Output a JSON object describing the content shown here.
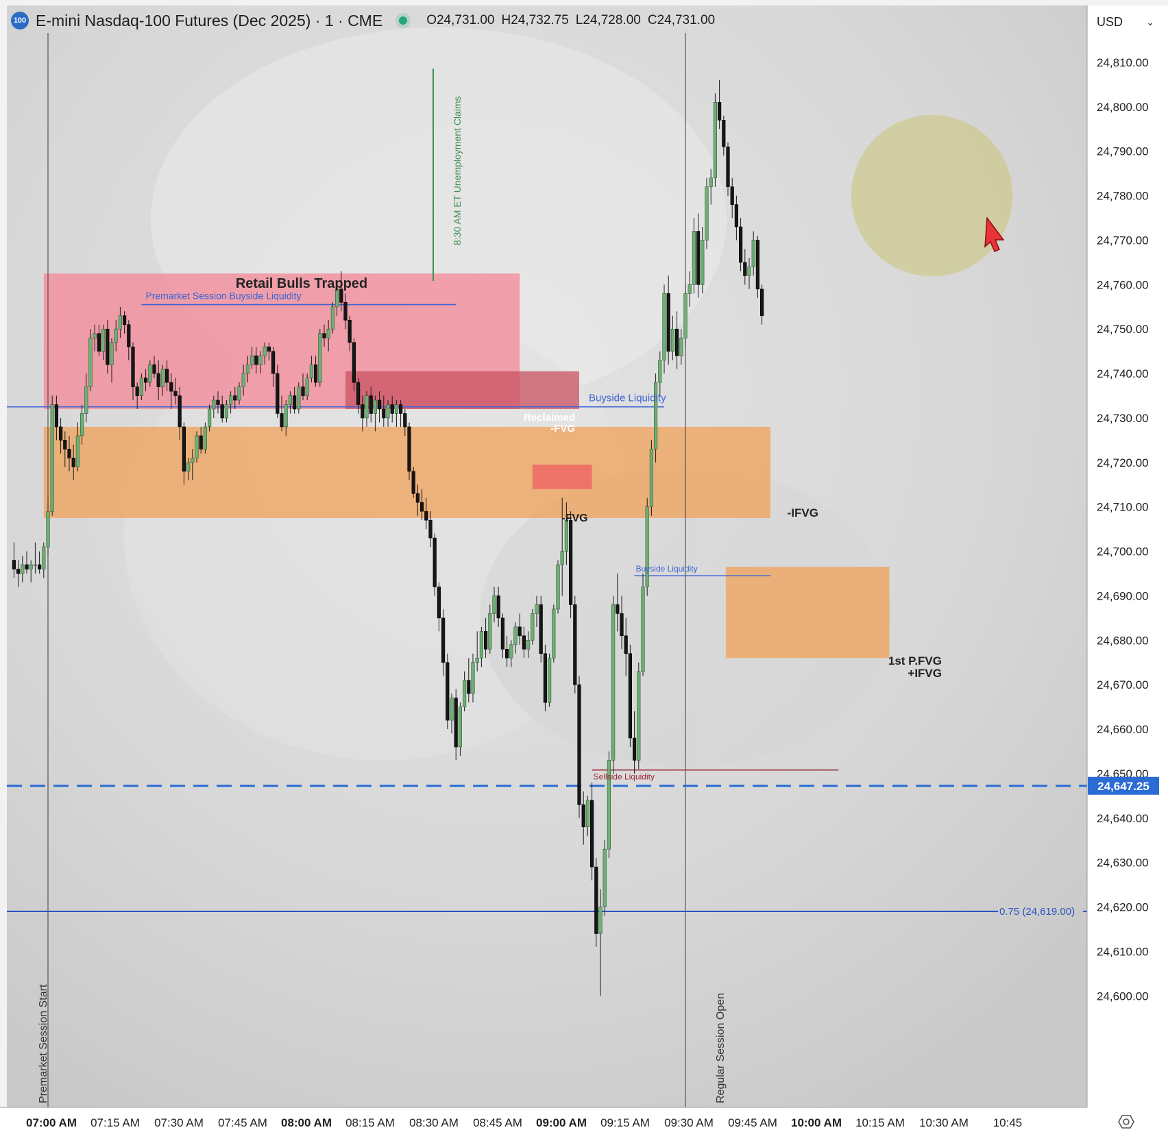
{
  "header": {
    "badge": "100",
    "title": "E-mini Nasdaq-100 Futures (Dec 2025) · 1 · CME",
    "open": "O24,731.00",
    "high": "H24,732.75",
    "low": "L24,728.00",
    "close": "C24,731.00"
  },
  "currency": "USD",
  "colors": {
    "up": "#6fae75",
    "down": "#161616",
    "blue_line": "#2a53c4",
    "red_zone": "#f28a9a",
    "orange_zone": "#f0a35e",
    "fvg_red": "#ee6264",
    "reclaimed_zone": "#c95363",
    "circle": "#cfc98f",
    "accent_label": "#2a6bd4"
  },
  "chart_data": {
    "type": "candlestick",
    "title": "E-mini Nasdaq-100 Futures (Dec 2025) · 1 · CME",
    "xlabel": "",
    "ylabel": "",
    "x_ticks": [
      {
        "t": "07:00 AM",
        "bold": true
      },
      {
        "t": "07:15 AM",
        "bold": false
      },
      {
        "t": "07:30 AM",
        "bold": false
      },
      {
        "t": "07:45 AM",
        "bold": false
      },
      {
        "t": "08:00 AM",
        "bold": true
      },
      {
        "t": "08:15 AM",
        "bold": false
      },
      {
        "t": "08:30 AM",
        "bold": false
      },
      {
        "t": "08:45 AM",
        "bold": false
      },
      {
        "t": "09:00 AM",
        "bold": true
      },
      {
        "t": "09:15 AM",
        "bold": false
      },
      {
        "t": "09:30 AM",
        "bold": false
      },
      {
        "t": "09:45 AM",
        "bold": false
      },
      {
        "t": "10:00 AM",
        "bold": true
      },
      {
        "t": "10:15 AM",
        "bold": false
      },
      {
        "t": "10:30 AM",
        "bold": false
      },
      {
        "t": "10:45",
        "bold": false
      }
    ],
    "y_ticks": [
      "24,600.00",
      "24,610.00",
      "24,620.00",
      "24,630.00",
      "24,640.00",
      "24,650.00",
      "24,660.00",
      "24,670.00",
      "24,680.00",
      "24,690.00",
      "24,700.00",
      "24,710.00",
      "24,720.00",
      "24,730.00",
      "24,740.00",
      "24,750.00",
      "24,760.00",
      "24,770.00",
      "24,780.00",
      "24,790.00",
      "24,800.00",
      "24,810.00"
    ],
    "ylim": [
      24596,
      24818
    ],
    "current_price": {
      "value": 24647.25,
      "label": "24,647.25"
    },
    "vertical_markers": [
      {
        "time_min": 0,
        "label": "Premarket Session Start"
      },
      {
        "time_min": 150,
        "label": "Regular Session Open"
      },
      {
        "time_min": 90,
        "label": "8:30 AM ET Unemployment Claims"
      }
    ],
    "zones": [
      {
        "name": "retail-bulls-trapped-zone",
        "t0": -1,
        "t1": 111,
        "p_low": 24732,
        "p_high": 24762.5,
        "color": "red_zone",
        "label": "Retail Bulls Trapped"
      },
      {
        "name": "reclaimed-fvg-zone",
        "t0": 70,
        "t1": 125,
        "p_low": 24732,
        "p_high": 24740.5,
        "color": "reclaimed_zone",
        "label": "Reclaimed -FVG"
      },
      {
        "name": "ifvg-zone",
        "t0": -1,
        "t1": 170,
        "p_low": 24707.5,
        "p_high": 24728,
        "color": "orange_zone",
        "label": "-IFVG"
      },
      {
        "name": "fvg-zone",
        "t0": 114,
        "t1": 128,
        "p_low": 24714,
        "p_high": 24719.5,
        "color": "fvg_red",
        "label": "-FVG"
      },
      {
        "name": "first-p-fvg-zone",
        "t0": 159.5,
        "t1": 198,
        "p_low": 24676,
        "p_high": 24696.5,
        "color": "orange_zone",
        "label": "1st P.FVG +IFVG"
      }
    ],
    "levels": [
      {
        "name": "premarket-buyside-liquidity",
        "t0": 22,
        "t1": 96,
        "price": 24755.5,
        "label": "Premarket Session Buyside Liquidity"
      },
      {
        "name": "buyside-liquidity",
        "t0": -10,
        "t1": 145,
        "price": 24732.5,
        "label": "Buyside Liquidity"
      },
      {
        "name": "buyside-liquidity-2",
        "t0": 138,
        "t1": 170,
        "price": 24694.5,
        "label": "Buyside Liquidity"
      },
      {
        "name": "sellside-liquidity",
        "t0": 128,
        "t1": 186,
        "price": 24650.8,
        "label": "Sellside Liquidity"
      },
      {
        "name": "fib-075",
        "t0": -10,
        "t1": 225,
        "price": 24619,
        "label": "0.75 (24,619.00)"
      }
    ],
    "circle": {
      "t": 208,
      "p": 24780,
      "r_min": 19
    },
    "candles": [
      [
        24698,
        24702,
        24694,
        24696
      ],
      [
        24696,
        24698,
        24692,
        24695
      ],
      [
        24695,
        24699,
        24693,
        24697
      ],
      [
        24697,
        24700,
        24695,
        24696
      ],
      [
        24696,
        24698,
        24693,
        24697
      ],
      [
        24697,
        24702,
        24695,
        24697
      ],
      [
        24697,
        24700,
        24695,
        24696
      ],
      [
        24696,
        24702,
        24694,
        24701
      ],
      [
        24701,
        24712,
        24699,
        24709
      ],
      [
        24709,
        24735,
        24708,
        24733
      ],
      [
        24733,
        24735,
        24725,
        24728
      ],
      [
        24728,
        24730,
        24722,
        24725
      ],
      [
        24725,
        24727,
        24719,
        24723
      ],
      [
        24723,
        24726,
        24718,
        24721
      ],
      [
        24721,
        24724,
        24716,
        24719
      ],
      [
        24719,
        24729,
        24718,
        24726
      ],
      [
        24726,
        24733,
        24724,
        24731
      ],
      [
        24731,
        24740,
        24729,
        24737
      ],
      [
        24737,
        24750,
        24736,
        24748
      ],
      [
        24748,
        24751,
        24745,
        24749
      ],
      [
        24749,
        24751,
        24744,
        24745
      ],
      [
        24745,
        24751,
        24743,
        24750
      ],
      [
        24750,
        24752,
        24740,
        24742
      ],
      [
        24742,
        24748,
        24738,
        24747
      ],
      [
        24747,
        24752,
        24745,
        24750
      ],
      [
        24750,
        24755,
        24748,
        24753
      ],
      [
        24753,
        24754,
        24749,
        24751
      ],
      [
        24751,
        24752,
        24743,
        24746
      ],
      [
        24746,
        24747,
        24734,
        24737
      ],
      [
        24737,
        24738,
        24732,
        24735
      ],
      [
        24735,
        24740,
        24734,
        24739
      ],
      [
        24739,
        24741,
        24736,
        24738
      ],
      [
        24738,
        24743,
        24737,
        24742
      ],
      [
        24742,
        24744,
        24739,
        24740
      ],
      [
        24740,
        24743,
        24734,
        24737
      ],
      [
        24737,
        24742,
        24735,
        24741
      ],
      [
        24741,
        24743,
        24736,
        24738
      ],
      [
        24738,
        24740,
        24732,
        24736
      ],
      [
        24736,
        24739,
        24733,
        24735
      ],
      [
        24735,
        24737,
        24725,
        24728
      ],
      [
        24728,
        24729,
        24715,
        24718
      ],
      [
        24718,
        24721,
        24716,
        24720
      ],
      [
        24720,
        24723,
        24716,
        24721
      ],
      [
        24721,
        24727,
        24720,
        24726
      ],
      [
        24726,
        24728,
        24722,
        24723
      ],
      [
        24723,
        24729,
        24722,
        24728
      ],
      [
        24728,
        24733,
        24727,
        24732
      ],
      [
        24732,
        24735,
        24730,
        24734
      ],
      [
        24734,
        24736,
        24731,
        24733
      ],
      [
        24733,
        24735,
        24729,
        24730
      ],
      [
        24730,
        24734,
        24729,
        24733
      ],
      [
        24733,
        24736,
        24731,
        24735
      ],
      [
        24735,
        24737,
        24732,
        24734
      ],
      [
        24734,
        24738,
        24733,
        24737
      ],
      [
        24737,
        24742,
        24735,
        24740
      ],
      [
        24740,
        24744,
        24738,
        24742
      ],
      [
        24742,
        24746,
        24741,
        24744
      ],
      [
        24744,
        24746,
        24740,
        24742
      ],
      [
        24742,
        24745,
        24740,
        24744
      ],
      [
        24744,
        24747,
        24742,
        24746
      ],
      [
        24746,
        24747,
        24743,
        24745
      ],
      [
        24745,
        24746,
        24737,
        24740
      ],
      [
        24740,
        24742,
        24730,
        24731
      ],
      [
        24731,
        24735,
        24727,
        24728
      ],
      [
        24728,
        24734,
        24726,
        24733
      ],
      [
        24733,
        24736,
        24731,
        24735
      ],
      [
        24735,
        24737,
        24731,
        24732
      ],
      [
        24732,
        24738,
        24731,
        24737
      ],
      [
        24737,
        24740,
        24734,
        24735
      ],
      [
        24735,
        24740,
        24734,
        24739
      ],
      [
        24739,
        24744,
        24738,
        24742
      ],
      [
        24742,
        24744,
        24737,
        24738
      ],
      [
        24738,
        24750,
        24737,
        24749
      ],
      [
        24749,
        24751,
        24746,
        24748
      ],
      [
        24748,
        24752,
        24745,
        24750
      ],
      [
        24750,
        24756,
        24749,
        24755
      ],
      [
        24755,
        24760,
        24753,
        24759
      ],
      [
        24759,
        24763,
        24754,
        24756
      ],
      [
        24756,
        24758,
        24750,
        24752
      ],
      [
        24752,
        24753,
        24745,
        24747
      ],
      [
        24747,
        24748,
        24736,
        24738
      ],
      [
        24738,
        24739,
        24731,
        24733
      ],
      [
        24733,
        24735,
        24727,
        24730
      ],
      [
        24730,
        24736,
        24728,
        24735
      ],
      [
        24735,
        24737,
        24729,
        24731
      ],
      [
        24731,
        24735,
        24727,
        24734
      ],
      [
        24734,
        24736,
        24729,
        24732
      ],
      [
        24732,
        24735,
        24728,
        24730
      ],
      [
        24730,
        24734,
        24728,
        24733
      ],
      [
        24733,
        24735,
        24729,
        24731
      ],
      [
        24731,
        24734,
        24728,
        24733
      ],
      [
        24733,
        24734,
        24728,
        24731
      ],
      [
        24731,
        24732,
        24726,
        24728
      ],
      [
        24728,
        24729,
        24716,
        24718
      ],
      [
        24718,
        24719,
        24712,
        24713
      ],
      [
        24713,
        24715,
        24708,
        24711
      ],
      [
        24711,
        24714,
        24707,
        24709
      ],
      [
        24709,
        24712,
        24705,
        24707
      ],
      [
        24707,
        24709,
        24701,
        24703
      ],
      [
        24703,
        24704,
        24690,
        24692
      ],
      [
        24692,
        24693,
        24682,
        24685
      ],
      [
        24685,
        24687,
        24672,
        24675
      ],
      [
        24675,
        24677,
        24660,
        24662
      ],
      [
        24662,
        24668,
        24659,
        24667
      ],
      [
        24667,
        24669,
        24653,
        24656
      ],
      [
        24656,
        24666,
        24654,
        24665
      ],
      [
        24665,
        24673,
        24664,
        24671
      ],
      [
        24671,
        24676,
        24666,
        24668
      ],
      [
        24668,
        24677,
        24666,
        24675
      ],
      [
        24675,
        24682,
        24673,
        24676
      ],
      [
        24676,
        24683,
        24674,
        24682
      ],
      [
        24682,
        24685,
        24676,
        24678
      ],
      [
        24678,
        24688,
        24677,
        24686
      ],
      [
        24686,
        24692,
        24684,
        24690
      ],
      [
        24690,
        24692,
        24683,
        24685
      ],
      [
        24685,
        24686,
        24676,
        24678
      ],
      [
        24678,
        24681,
        24674,
        24676
      ],
      [
        24676,
        24680,
        24674,
        24679
      ],
      [
        24679,
        24684,
        24677,
        24683
      ],
      [
        24683,
        24686,
        24679,
        24681
      ],
      [
        24681,
        24683,
        24676,
        24678
      ],
      [
        24678,
        24682,
        24676,
        24680
      ],
      [
        24680,
        24687,
        24679,
        24686
      ],
      [
        24686,
        24690,
        24683,
        24688
      ],
      [
        24688,
        24690,
        24675,
        24677
      ],
      [
        24677,
        24679,
        24664,
        24666
      ],
      [
        24666,
        24677,
        24665,
        24676
      ],
      [
        24676,
        24688,
        24675,
        24687
      ],
      [
        24687,
        24698,
        24686,
        24697
      ],
      [
        24697,
        24712,
        24690,
        24700
      ],
      [
        24700,
        24711,
        24697,
        24707
      ],
      [
        24707,
        24709,
        24685,
        24688
      ],
      [
        24688,
        24690,
        24668,
        24670
      ],
      [
        24670,
        24672,
        24640,
        24643
      ],
      [
        24643,
        24646,
        24634,
        24638
      ],
      [
        24638,
        24645,
        24636,
        24644
      ],
      [
        24644,
        24648,
        24626,
        24629
      ],
      [
        24629,
        24631,
        24611,
        24614
      ],
      [
        24614,
        24624,
        24600,
        24620
      ],
      [
        24620,
        24635,
        24618,
        24633
      ],
      [
        24633,
        24655,
        24631,
        24653
      ],
      [
        24653,
        24690,
        24650,
        24688
      ],
      [
        24688,
        24695,
        24682,
        24686
      ],
      [
        24686,
        24690,
        24678,
        24681
      ],
      [
        24681,
        24685,
        24672,
        24677
      ],
      [
        24677,
        24679,
        24656,
        24658
      ],
      [
        24658,
        24664,
        24650,
        24653
      ],
      [
        24653,
        24675,
        24651,
        24673
      ],
      [
        24673,
        24695,
        24672,
        24692
      ],
      [
        24692,
        24712,
        24690,
        24710
      ],
      [
        24710,
        24725,
        24708,
        24723
      ],
      [
        24723,
        24740,
        24720,
        24738
      ],
      [
        24738,
        24745,
        24735,
        24743
      ],
      [
        24743,
        24760,
        24740,
        24758
      ],
      [
        24758,
        24762,
        24742,
        24745
      ],
      [
        24745,
        24753,
        24743,
        24750
      ],
      [
        24750,
        24754,
        24741,
        24744
      ],
      [
        24744,
        24750,
        24742,
        24748
      ],
      [
        24748,
        24760,
        24746,
        24758
      ],
      [
        24758,
        24763,
        24755,
        24760
      ],
      [
        24760,
        24775,
        24758,
        24772
      ],
      [
        24772,
        24776,
        24757,
        24760
      ],
      [
        24760,
        24773,
        24758,
        24770
      ],
      [
        24770,
        24784,
        24768,
        24782
      ],
      [
        24782,
        24786,
        24778,
        24784
      ],
      [
        24784,
        24803,
        24782,
        24801
      ],
      [
        24801,
        24806,
        24795,
        24797
      ],
      [
        24797,
        24798,
        24789,
        24791
      ],
      [
        24791,
        24792,
        24780,
        24782
      ],
      [
        24782,
        24784,
        24775,
        24778
      ],
      [
        24778,
        24780,
        24770,
        24773
      ],
      [
        24773,
        24775,
        24763,
        24765
      ],
      [
        24765,
        24768,
        24760,
        24762
      ],
      [
        24762,
        24766,
        24759,
        24764
      ],
      [
        24764,
        24772,
        24762,
        24770
      ],
      [
        24770,
        24771,
        24757,
        24759
      ],
      [
        24759,
        24760,
        24751,
        24753
      ]
    ]
  }
}
